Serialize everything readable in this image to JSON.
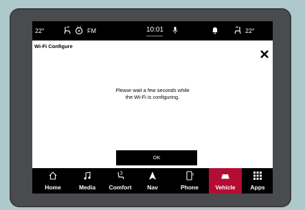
{
  "status_bar": {
    "left_temp": "22°",
    "radio_band": "FM",
    "clock": "10:01",
    "right_temp": "22°",
    "icons": [
      "heated-seat-icon",
      "steering-wheel-heat-icon",
      "microphone-icon",
      "bell-icon",
      "seat-heat-icon"
    ]
  },
  "dialog": {
    "title": "Wi-Fi Configure",
    "message_line1": "Please wait a few seconds while",
    "message_line2": "the Wi-Fi is configuring.",
    "ok_label": "OK",
    "close_icon": "close-icon"
  },
  "nav": {
    "active": "Vehicle",
    "accent_color": "#b30d33",
    "items": [
      {
        "label": "Home",
        "icon": "home-icon"
      },
      {
        "label": "Media",
        "icon": "music-note-icon"
      },
      {
        "label": "Comfort",
        "icon": "comfort-seat-icon"
      },
      {
        "label": "Nav",
        "icon": "navigation-arrow-icon"
      },
      {
        "label": "Phone",
        "icon": "phone-icon"
      },
      {
        "label": "Vehicle",
        "icon": "car-icon"
      },
      {
        "label": "Apps",
        "icon": "apps-grid-icon"
      }
    ]
  }
}
